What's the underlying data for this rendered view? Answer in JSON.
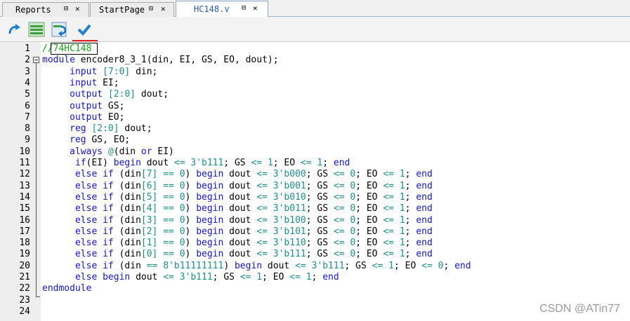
{
  "tabs": [
    {
      "label": "Reports",
      "pin": "⊟",
      "close": "✕"
    },
    {
      "label": "StartPage",
      "pin": "⊟",
      "close": "✕"
    },
    {
      "label": "HC148.v",
      "pin": "⊟",
      "close": "✕"
    }
  ],
  "toolbar": {
    "icons": [
      "redo-icon",
      "compile-lines-icon",
      "wrap-icon",
      "check-icon"
    ]
  },
  "editor": {
    "lines": [
      {
        "n": "1",
        "code": "//74HC148"
      },
      {
        "n": "2",
        "code": "module encoder8_3_1(din, EI, GS, EO, dout);"
      },
      {
        "n": "3",
        "code": "     input [7:0] din;"
      },
      {
        "n": "4",
        "code": "     input EI;"
      },
      {
        "n": "5",
        "code": "     output [2:0] dout;"
      },
      {
        "n": "6",
        "code": "     output GS;"
      },
      {
        "n": "7",
        "code": "     output EO;"
      },
      {
        "n": "8",
        "code": "     reg [2:0] dout;"
      },
      {
        "n": "9",
        "code": "     reg GS, EO;"
      },
      {
        "n": "10",
        "code": "     always @(din or EI)"
      },
      {
        "n": "11",
        "code": "      if(EI) begin dout <= 3'b111; GS <= 1; EO <= 1; end"
      },
      {
        "n": "12",
        "code": "      else if (din[7] == 0) begin dout <= 3'b000; GS <= 0; EO <= 1; end"
      },
      {
        "n": "13",
        "code": "      else if (din[6] == 0) begin dout <= 3'b001; GS <= 0; EO <= 1; end"
      },
      {
        "n": "14",
        "code": "      else if (din[5] == 0) begin dout <= 3'b010; GS <= 0; EO <= 1; end"
      },
      {
        "n": "15",
        "code": "      else if (din[4] == 0) begin dout <= 3'b011; GS <= 0; EO <= 1; end"
      },
      {
        "n": "16",
        "code": "      else if (din[3] == 0) begin dout <= 3'b100; GS <= 0; EO <= 1; end"
      },
      {
        "n": "17",
        "code": "      else if (din[2] == 0) begin dout <= 3'b101; GS <= 0; EO <= 1; end"
      },
      {
        "n": "18",
        "code": "      else if (din[1] == 0) begin dout <= 3'b110; GS <= 0; EO <= 1; end"
      },
      {
        "n": "19",
        "code": "      else if (din[0] == 0) begin dout <= 3'b111; GS <= 0; EO <= 1; end"
      },
      {
        "n": "20",
        "code": "      else if (din == 8'b11111111) begin dout <= 3'b111; GS <= 1; EO <= 0; end"
      },
      {
        "n": "21",
        "code": "      else begin dout <= 3'b111; GS <= 1; EO <= 1; end"
      },
      {
        "n": "22",
        "code": "endmodule"
      },
      {
        "n": "23",
        "code": ""
      },
      {
        "n": "24",
        "code": ""
      }
    ]
  },
  "watermark": "CSDN @ATin77",
  "colors": {
    "keyword": "#1515c8",
    "number": "#1e8c8c",
    "comment": "#18a018",
    "active_tab_text": "#2a58b0"
  }
}
